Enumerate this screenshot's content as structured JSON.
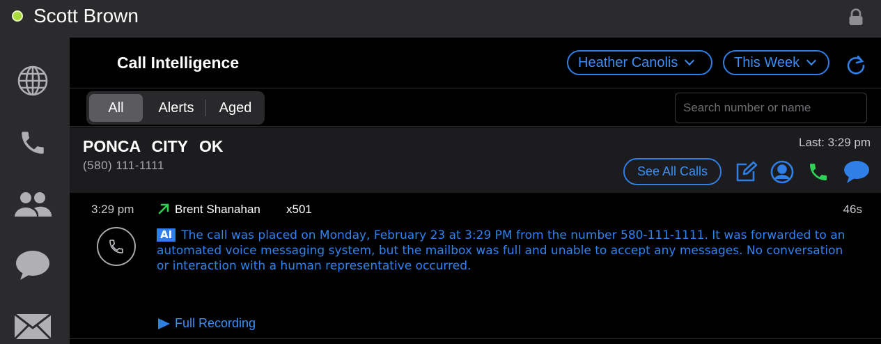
{
  "topbar": {
    "user_name": "Scott Brown",
    "status_color": "#a9dc3a",
    "lock_icon": "lock-icon"
  },
  "sidebar": {
    "items": [
      {
        "icon": "globe-icon"
      },
      {
        "icon": "phone-icon"
      },
      {
        "icon": "people-icon"
      },
      {
        "icon": "chat-bubble-icon"
      },
      {
        "icon": "mail-icon"
      }
    ]
  },
  "header": {
    "title": "Call Intelligence",
    "agent_filter": "Heather Canolis",
    "period_filter": "This Week",
    "refresh_icon": "refresh-icon"
  },
  "filters": {
    "tabs": [
      "All",
      "Alerts",
      "Aged"
    ],
    "active_tab": "All",
    "search_placeholder": "Search number or name"
  },
  "contact": {
    "name": "PONCA CITY OK",
    "phone": "(580) 111-1111",
    "last_call": "Last: 3:29 pm",
    "see_all_label": "See All Calls",
    "action_icons": [
      "edit-icon",
      "contact-icon",
      "call-icon",
      "message-icon"
    ]
  },
  "call": {
    "time": "3:29 pm",
    "direction": "outgoing",
    "agent": "Brent Shanahan",
    "extension": "x501",
    "duration": "46s",
    "ai_badge": "AI",
    "summary": "The call was placed on Monday, February 23 at 3:29 PM from the number 580-111-1111. It was forwarded to an automated voice messaging system, but the mailbox was full and unable to accept any messages. No conversation or interaction with a human representative occurred.",
    "recording_label": "Full Recording"
  },
  "colors": {
    "accent": "#2f7fe6",
    "call_green": "#30d158",
    "background": "#000000",
    "panel": "#2b2b2d"
  }
}
